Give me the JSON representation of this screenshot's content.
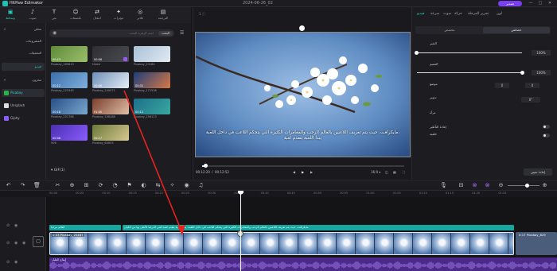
{
  "app": {
    "name": "HitPaw Edimakor",
    "doc_title": "2024-06-26_02",
    "export_label": "تصدير",
    "win_min": "—",
    "win_max": "□",
    "win_close": "✕"
  },
  "toolbar": {
    "items": [
      {
        "label": "وسائط",
        "icon": "media-icon",
        "active": true
      },
      {
        "label": "صوت",
        "icon": "music-icon"
      },
      {
        "label": "نص",
        "icon": "text-icon"
      },
      {
        "label": "ملصقات",
        "icon": "sticker-icon"
      },
      {
        "label": "انتقال",
        "icon": "transition-icon"
      },
      {
        "label": "مؤثرات",
        "icon": "effects-icon"
      },
      {
        "label": "فلاتر",
        "icon": "filter-icon"
      },
      {
        "label": "الترجمة",
        "icon": "subtitle-icon"
      }
    ]
  },
  "leftnav": {
    "items": [
      {
        "label": "محلي",
        "expand": "▾",
        "selected": false
      },
      {
        "label": "المشروعات",
        "selected": false
      },
      {
        "label": "التحميلات",
        "selected": false
      },
      {
        "label": "فيديو",
        "selected": true
      },
      {
        "label": "مخزون",
        "expand": "▾",
        "selected": false
      }
    ],
    "sources": [
      {
        "label": "Pixabay",
        "color": "#2ab24a",
        "selected": true
      },
      {
        "label": "Unsplash",
        "color": "#dddddd",
        "selected": false
      },
      {
        "label": "Giphy",
        "color": "#8a5cff",
        "selected": false
      }
    ]
  },
  "media": {
    "search_placeholder": "اسم الزهرة البحث",
    "search_button": "البحث",
    "thumbs": [
      {
        "dur": "00:23",
        "label": "Pixabay_189813",
        "c1": "#5d8a3a",
        "c2": "#9cc06a"
      },
      {
        "dur": "00:06",
        "label": "Home",
        "c1": "#2e2e33",
        "c2": "#4a4a52",
        "pin": true
      },
      {
        "dur": "",
        "label": "Pixabay_23184",
        "c1": "#a9c0d6",
        "c2": "#e2eaf2"
      },
      {
        "dur": "00:12",
        "label": "Pixabay_225345",
        "c1": "#3b6fa8",
        "c2": "#7fb0de"
      },
      {
        "dur": "00:06",
        "label": "Pixabay_240071",
        "c1": "#6d8fb8",
        "c2": "#e6eef6"
      },
      {
        "dur": "00:31",
        "label": "Pixabay_172538",
        "c1": "#1e3f7a",
        "c2": "#d87845"
      },
      {
        "dur": "00:18",
        "label": "Pixabay_201766",
        "c1": "#284f86",
        "c2": "#7aa8d0"
      },
      {
        "dur": "01:00",
        "label": "Pixabay_198488",
        "c1": "#7a3e2c",
        "c2": "#e0c0a8"
      },
      {
        "dur": "00:12",
        "label": "Pixabay_256113",
        "c1": "#1d6f8a",
        "c2": "#3aa8a0"
      },
      {
        "dur": "00:08",
        "label": "906",
        "c1": "#4a2fb0",
        "c2": "#8a5cff"
      },
      {
        "dur": "00:17",
        "label": "Pixabay_60653",
        "c1": "#6a7a3a",
        "c2": "#d8c890"
      }
    ],
    "gif_label": "▾ GIF(1)"
  },
  "viewer": {
    "header": "1 ⓘ",
    "subtitle_line1": "مايكرافت، حيث يتم تعريف اللاعبين بالعالم الرحب والمغامرات الكثيرة التي يتحكم اللاعب في داخل اللعبة،",
    "subtitle_line2": "يبدأ اللعبة بتقدم لعبة",
    "time_current": "00:12:20",
    "time_total": "00:12:52",
    "play_prev": "◀",
    "play": "▶",
    "play_next": "▶",
    "aspect": "16:9 ▾",
    "progress_fraction": 0.016
  },
  "rightpanel": {
    "tabs": [
      "فيديو",
      "سرعة",
      "صوت",
      "حركة",
      "تحرير المرحلة",
      "لون"
    ],
    "selected_tab": "فيديو",
    "segments": [
      "خصائص",
      "مخصص"
    ],
    "opacity_label": "التغير",
    "opacity_value": "100%",
    "blend_label": "التعتيم",
    "blend_value": "100%",
    "position_label": "موضع",
    "x_value": "0",
    "y_value": "0",
    "rotate_label": "تدوير",
    "rotate_value": "0°",
    "flip_label": "مرآة",
    "autoreframe_label": "إعادة التأطير",
    "bg_label": "خلفية",
    "reset_label": "إعادة تعيين"
  },
  "timeline": {
    "ruler": [
      "00:00",
      "00:05",
      "00:10",
      "00:15",
      "00:20",
      "00:25",
      "00:30",
      "00:35",
      "00:40",
      "00:45",
      "00:50",
      "00:55",
      "01:00",
      "01:05",
      "01:10",
      "01:15",
      "01:20",
      "01:25"
    ],
    "sub_clips": [
      {
        "text": "العالم مرحبا"
      },
      {
        "text": "مايكرافت، حيث يتم تعريف اللاعبين بالعالم الرحب والمغامرات الكثيرة التي يتحكم اللاعب في داخل اللعبة، يبدأ اللعبة بتقدم لعبة  أغني الدراما الأعلى  بها من الكيان"
      }
    ],
    "video_clip_label": "0:03 Pixabay_20467",
    "video_clip2_label": "0:17 Pixabay_829",
    "audio_clip_label": "إيقاع الطبل"
  }
}
